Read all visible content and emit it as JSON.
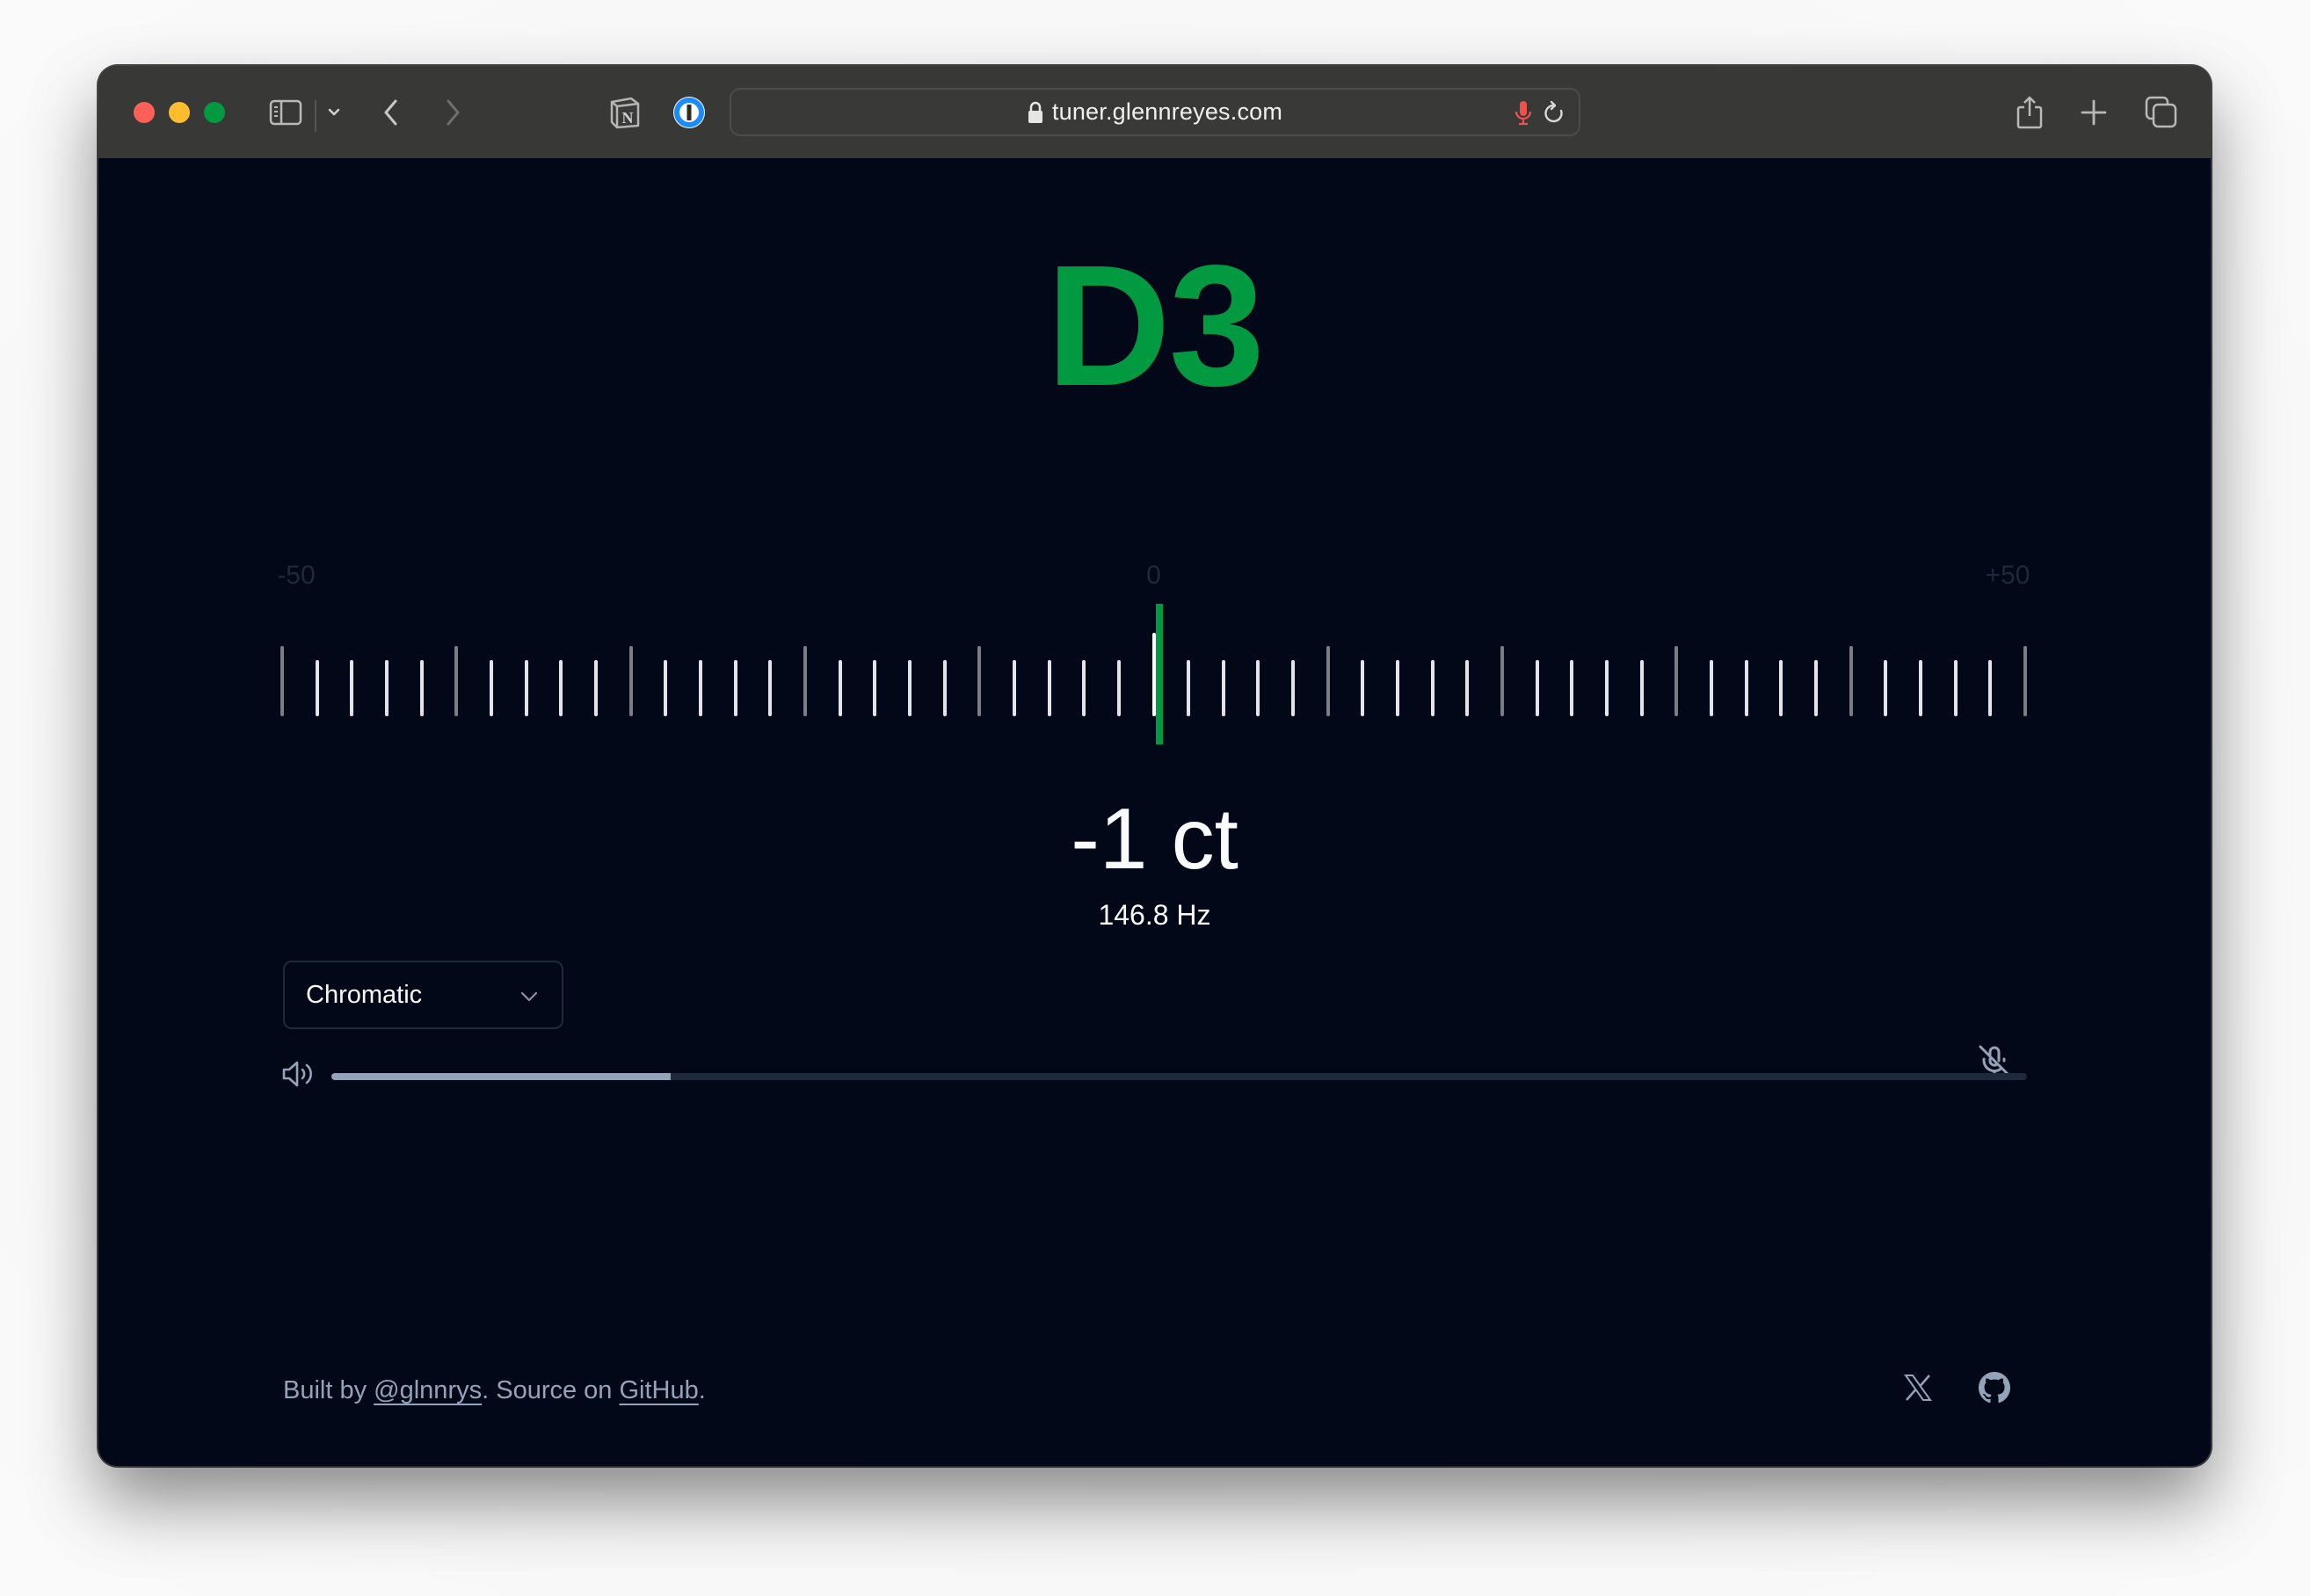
{
  "browser": {
    "url": "tuner.glennreyes.com",
    "toolbar_icons": [
      "sidebar-icon",
      "chevron-down-icon",
      "back-icon",
      "forward-icon",
      "notion-extension-icon",
      "1password-extension-icon",
      "share-icon",
      "new-tab-icon",
      "tab-overview-icon"
    ],
    "url_icons": [
      "lock-icon",
      "microphone-in-use-icon",
      "reload-icon"
    ],
    "mic_indicator_color": "#f0524a"
  },
  "tuner": {
    "note": "D3",
    "note_color": "#029a41",
    "scale": {
      "min_label": "-50",
      "center_label": "0",
      "max_label": "+50",
      "min_cents": -50,
      "max_cents": 50,
      "tick_step_cents": 2,
      "major_every_cents": 10
    },
    "needle_cents": -1,
    "cents_display": "-1 ct",
    "frequency_display": "146.8 Hz"
  },
  "controls": {
    "mode_select": {
      "selected": "Chromatic"
    },
    "mic_button_icon": "mic-off-icon",
    "volume": {
      "icon": "volume-icon",
      "level_percent": 20
    }
  },
  "footer": {
    "built_by_prefix": "Built by ",
    "author_link": "@glnnrys",
    "middle_text": ". Source on ",
    "source_link": "GitHub",
    "suffix": ".",
    "social_icons": [
      "x-icon",
      "github-icon"
    ]
  }
}
